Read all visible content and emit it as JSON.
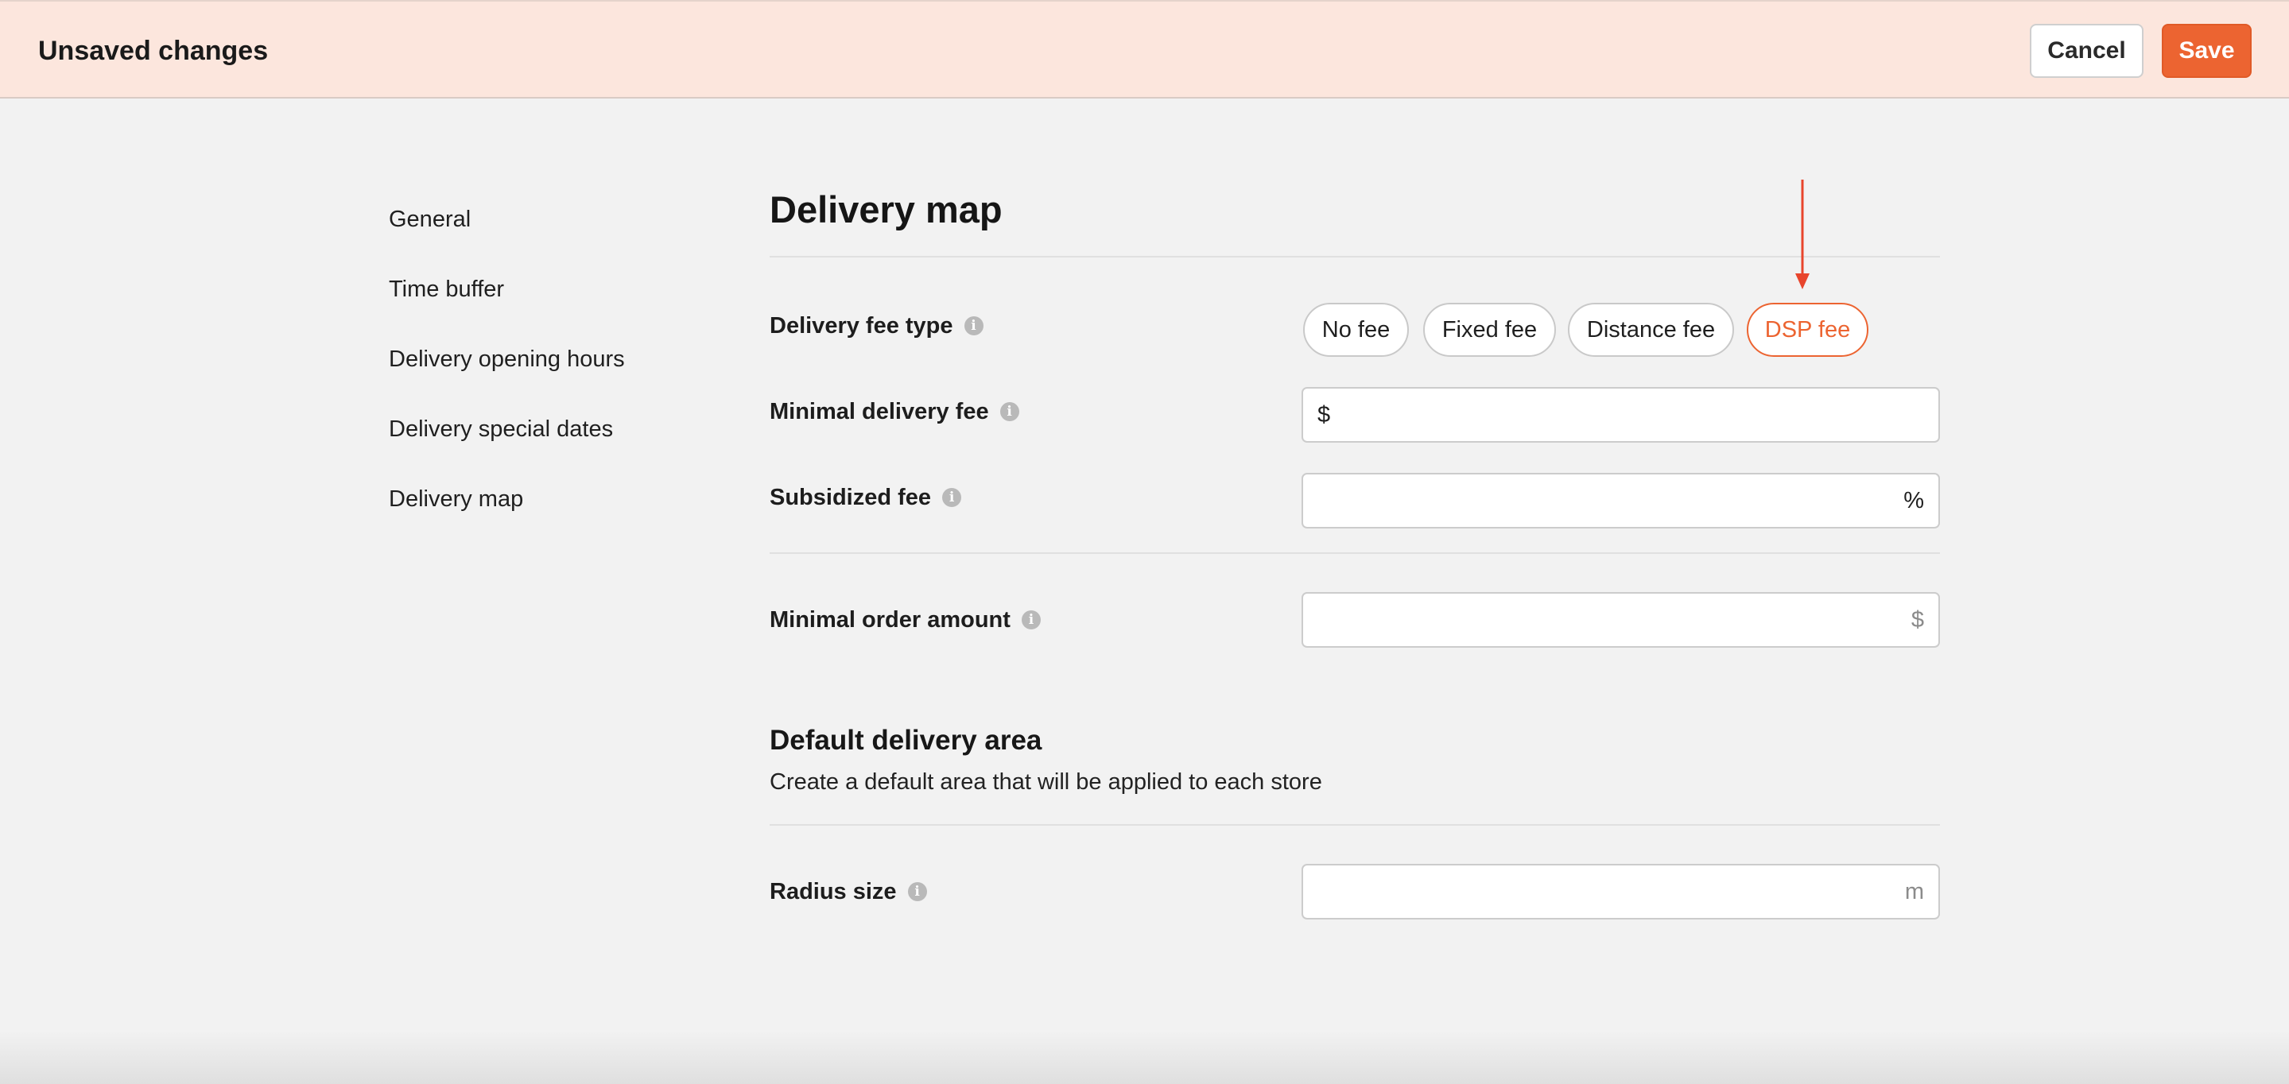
{
  "topbar": {
    "title": "Unsaved changes",
    "cancel_label": "Cancel",
    "save_label": "Save"
  },
  "sidebar": {
    "items": [
      {
        "label": "General"
      },
      {
        "label": "Time buffer"
      },
      {
        "label": "Delivery opening hours"
      },
      {
        "label": "Delivery special dates"
      },
      {
        "label": "Delivery map"
      }
    ]
  },
  "main": {
    "title": "Delivery map",
    "delivery_fee_type": {
      "label": "Delivery fee type",
      "options": [
        "No fee",
        "Fixed fee",
        "Distance fee",
        "DSP fee"
      ],
      "selected": "DSP fee"
    },
    "minimal_delivery_fee": {
      "label": "Minimal delivery fee",
      "prefix": "$",
      "value": ""
    },
    "subsidized_fee": {
      "label": "Subsidized fee",
      "suffix": "%",
      "value": ""
    },
    "minimal_order_amount": {
      "label": "Minimal order amount",
      "suffix": "$",
      "value": ""
    },
    "default_area": {
      "title": "Default delivery area",
      "subtitle": "Create a default area that will be applied to each store"
    },
    "radius_size": {
      "label": "Radius size",
      "suffix": "m",
      "value": ""
    }
  },
  "icons": {
    "info": "info-icon",
    "annotation_arrow": "arrow-down-icon"
  },
  "colors": {
    "accent": "#ec6431",
    "topbar_bg": "#fce6dd",
    "page_bg": "#f2f2f2",
    "arrow": "#e8452c"
  }
}
